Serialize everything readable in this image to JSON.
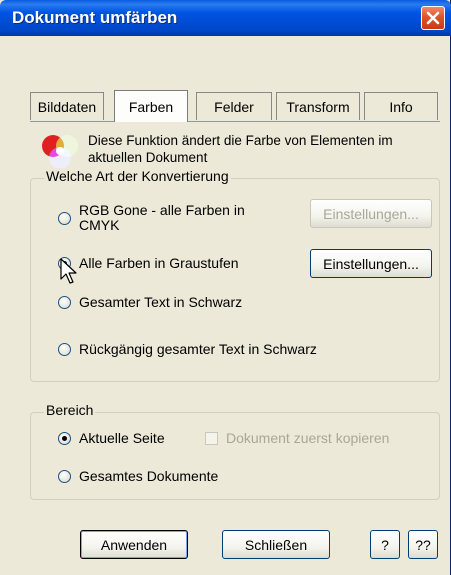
{
  "window": {
    "title": "Dokument umfärben",
    "close_icon": "close-icon",
    "colors": {
      "titlebar": "#0054e3",
      "close": "#e0522c",
      "face": "#ece9d8"
    }
  },
  "tabs": [
    {
      "label": "Bilddaten",
      "active": false
    },
    {
      "label": "Farben",
      "active": true
    },
    {
      "label": "Felder",
      "active": false
    },
    {
      "label": "Transform",
      "active": false
    },
    {
      "label": "Info",
      "active": false
    }
  ],
  "info": {
    "icon": "rgb-circles-icon",
    "text": "Diese Funktion ändert die Farbe von Elementen im aktuellen Dokument"
  },
  "conversion_group": {
    "legend": "Welche Art der Konvertierung",
    "options": [
      {
        "label": "RGB Gone - alle Farben in CMYK",
        "checked": false
      },
      {
        "label": "Alle Farben in Graustufen",
        "checked": true
      },
      {
        "label": "Gesamter Text in Schwarz",
        "checked": false
      },
      {
        "label": "Rückgängig gesamter Text in Schwarz",
        "checked": false
      }
    ],
    "settings_buttons": [
      {
        "label": "Einstellungen...",
        "enabled": false
      },
      {
        "label": "Einstellungen...",
        "enabled": true
      }
    ]
  },
  "range_group": {
    "legend": "Bereich",
    "options": [
      {
        "label": "Aktuelle Seite",
        "checked": true
      },
      {
        "label": "Gesamtes Dokumente",
        "checked": false
      }
    ],
    "copy_checkbox": {
      "label": "Dokument zuerst kopieren",
      "checked": false,
      "enabled": false
    }
  },
  "footer": {
    "apply_label": "Anwenden",
    "close_label": "Schließen",
    "help_label": "?",
    "help2_label": "??"
  }
}
